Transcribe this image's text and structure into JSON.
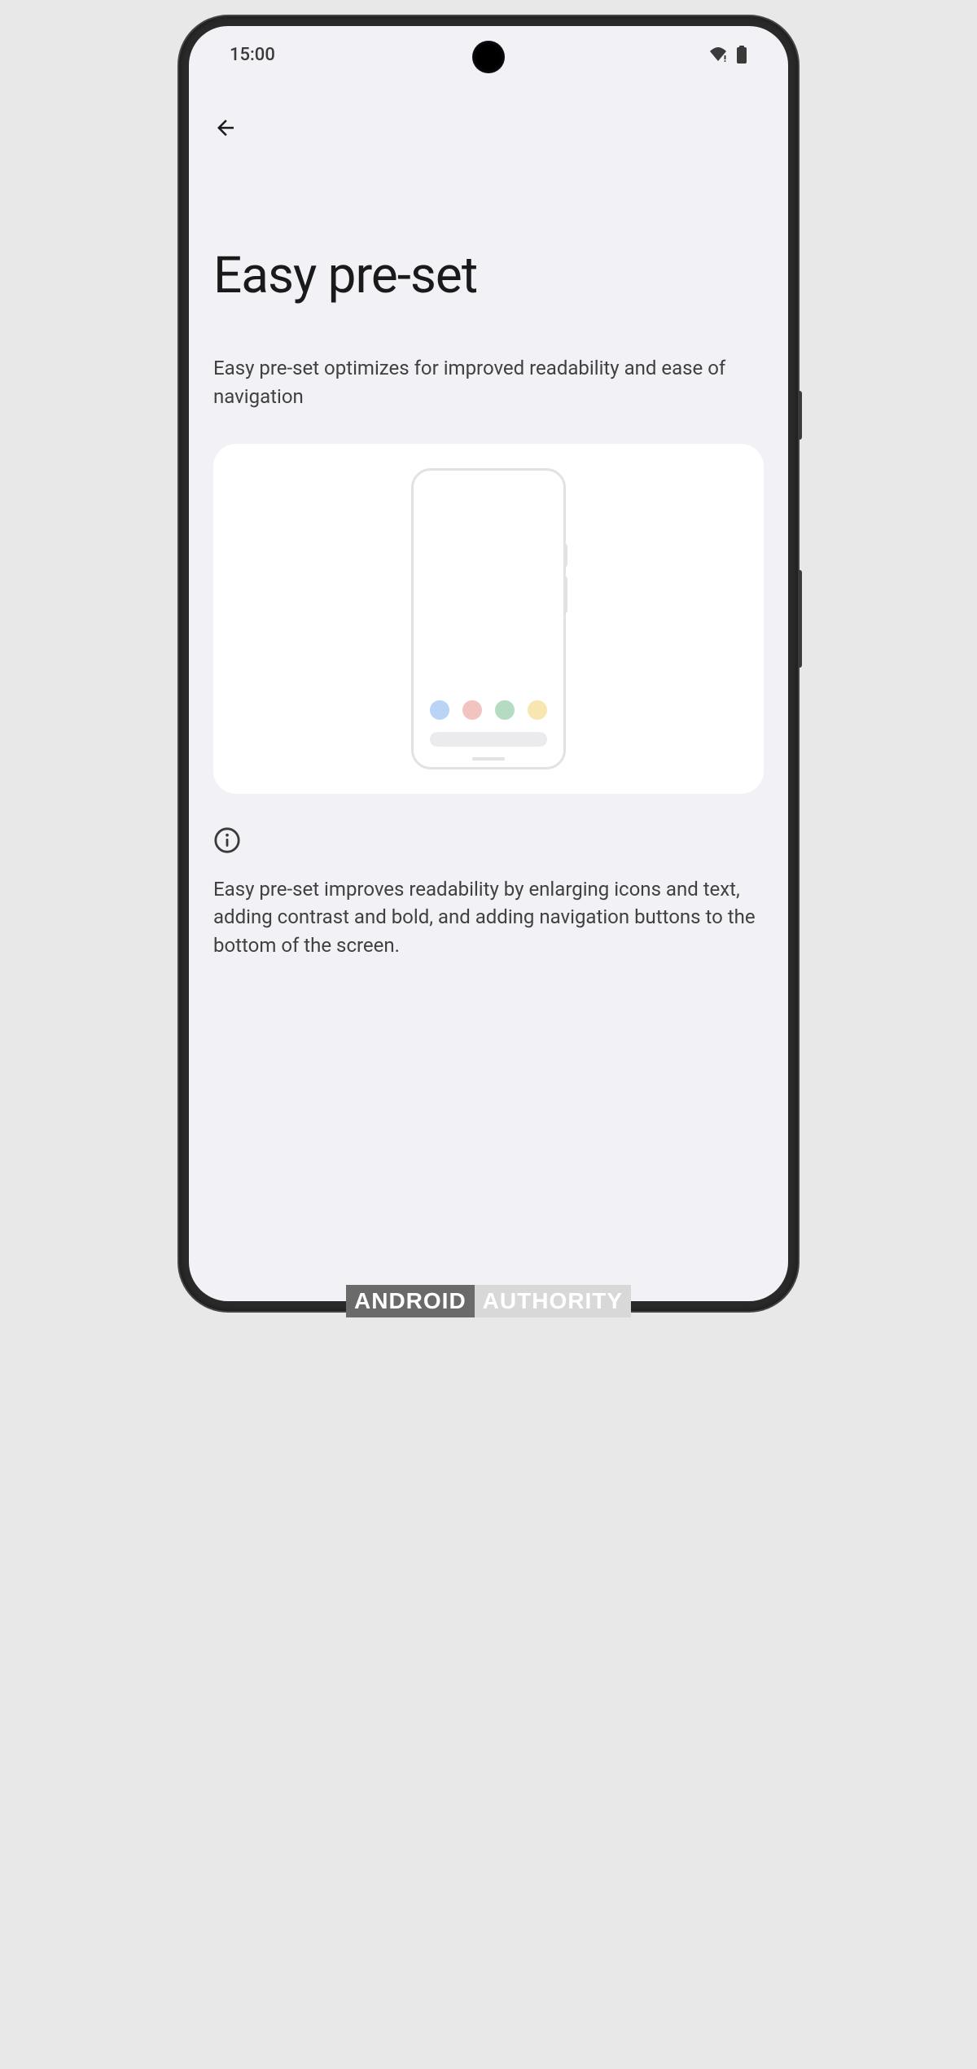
{
  "status": {
    "time": "15:00"
  },
  "page": {
    "title": "Easy pre-set",
    "subtitle": "Easy pre-set optimizes for improved readability and ease of navigation",
    "detail": "Easy pre-set improves readability by enlarging icons and text, adding contrast and bold, and adding navigation buttons to the bottom of the screen."
  },
  "watermark": {
    "part1": "ANDROID",
    "part2": "AUTHORITY"
  }
}
